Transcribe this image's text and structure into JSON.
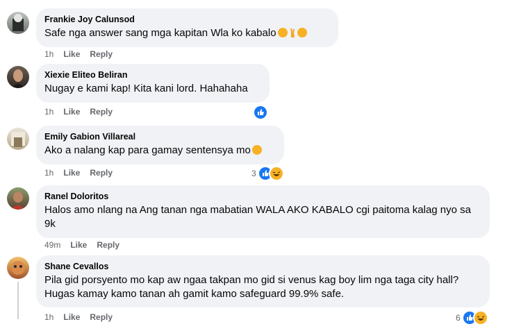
{
  "comments": [
    {
      "author": "Frankie Joy Calunsod",
      "text": "Safe nga answer sang mga kapitan Wla ko kabalo",
      "time": "1h",
      "like": "Like",
      "reply": "Reply",
      "reaction_count": ""
    },
    {
      "author": "Xiexie Eliteo Beliran",
      "text": "Nugay e kami kap! Kita kani lord. Hahahaha",
      "time": "1h",
      "like": "Like",
      "reply": "Reply",
      "reaction_count": ""
    },
    {
      "author": "Emily Gabion Villareal",
      "text": "Ako a nalang kap para gamay sentensya mo",
      "time": "1h",
      "like": "Like",
      "reply": "Reply",
      "reaction_count": "3"
    },
    {
      "author": "Ranel Doloritos",
      "text": "Halos amo nlang na Ang tanan nga mabatian WALA AKO KABALO cgi paitoma kalag nyo sa 9k",
      "time": "49m",
      "like": "Like",
      "reply": "Reply",
      "reaction_count": ""
    },
    {
      "author": "Shane Cevallos",
      "text": "Pila gid porsyento mo kap aw ngaa takpan mo gid si venus kag boy lim nga taga city hall? Hugas kamay kamo tanan ah gamit kamo safeguard 99.9% safe.",
      "time": "1h",
      "like": "Like",
      "reply": "Reply",
      "reaction_count": "6"
    }
  ],
  "colors": {
    "bubble": "#f0f2f5",
    "meta": "#65676b",
    "like_blue": "#1877f2",
    "haha_yellow": "#f7b125"
  }
}
